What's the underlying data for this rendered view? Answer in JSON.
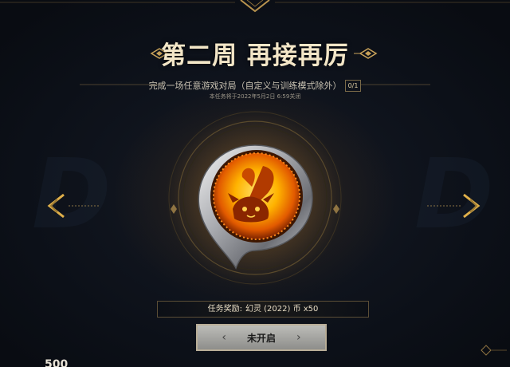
{
  "event": {
    "title": "第二周 再接再厉",
    "task_description": "完成一场任意游戏对局（自定义与训练模式除外）",
    "task_progress": "0/1",
    "deadline_note": "本任务将于2022年5月2日 6:59关闭",
    "reward_label": "任务奖励:",
    "reward_value": "幻灵 (2022) 币 x50",
    "start_button_label": "未开启",
    "bottom_counter": "500"
  },
  "icons": {
    "prev": "chevron-left-icon",
    "next": "chevron-right-icon",
    "emblem": "poro-badge-emblem-icon"
  },
  "colors": {
    "gold": "#c9a35a",
    "title": "#f3e6c7",
    "button": "#a7a7a3"
  }
}
